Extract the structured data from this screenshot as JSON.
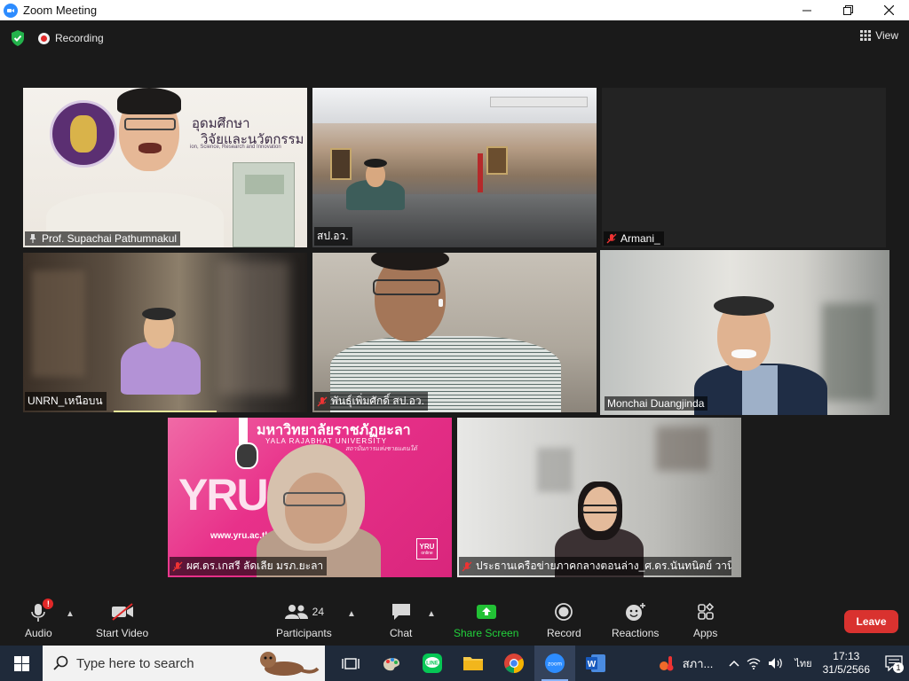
{
  "window": {
    "title": "Zoom Meeting",
    "controls": [
      "minimize",
      "maximize",
      "close"
    ]
  },
  "topbar": {
    "recording_label": "Recording",
    "view_label": "View"
  },
  "participants": [
    {
      "name": "Prof. Supachai Pathumnakul",
      "icon": "pin-icon",
      "muted": false
    },
    {
      "name": "สป.อว.",
      "icon": "",
      "muted": false
    },
    {
      "name": "Armani_",
      "icon": "mic-muted-icon",
      "muted": true
    },
    {
      "name": "UNRN_เหนือบน",
      "icon": "",
      "muted": false
    },
    {
      "name": "พันธุ์เพิ่มศักดิ์ สป.อว.",
      "icon": "mic-muted-icon",
      "muted": true
    },
    {
      "name": "Monchai Duangjinda",
      "icon": "",
      "muted": false,
      "active_speaker": true
    },
    {
      "name": "ผศ.ดร.เกสรี ลัดเลีย มรภ.ยะลา",
      "icon": "mic-muted-icon",
      "muted": true
    },
    {
      "name": "ประธานเครือข่ายภาคกลางตอนล่าง_ศ.ดร.นันทนิตย์ วานิชา...",
      "icon": "mic-muted-icon",
      "muted": true
    }
  ],
  "backgrounds": {
    "tile1_text1": "อุดมศึกษา",
    "tile1_text2": "วิจัยและนวัตกรรม",
    "tile1_text3": "ion, Science, Research and Innovation",
    "tile7_title_th": "มหาวิทยาลัยราชภัฏยะลา",
    "tile7_title_en": "YALA RAJABHAT UNIVERSITY",
    "tile7_slogan": "สถาบันการแห่งชายแดนใต้",
    "tile7_logo": "YRU",
    "tile7_url": "www.yru.ac.th",
    "tile7_badge": "YRU",
    "tile7_badge_sub": "online"
  },
  "controls": {
    "audio": "Audio",
    "start_video": "Start Video",
    "participants": "Participants",
    "participants_count": "24",
    "chat": "Chat",
    "share_screen": "Share Screen",
    "record": "Record",
    "reactions": "Reactions",
    "apps": "Apps",
    "leave": "Leave"
  },
  "taskbar": {
    "search_placeholder": "Type here to search",
    "weather_text": "สภา...",
    "language": "ไทย",
    "time": "17:13",
    "date": "31/5/2566",
    "notifications": "1"
  },
  "colors": {
    "accent_green": "#22d13b",
    "leave_red": "#d9322f",
    "active_speaker": "#c8e06b",
    "yru_pink": "#e8318a"
  }
}
